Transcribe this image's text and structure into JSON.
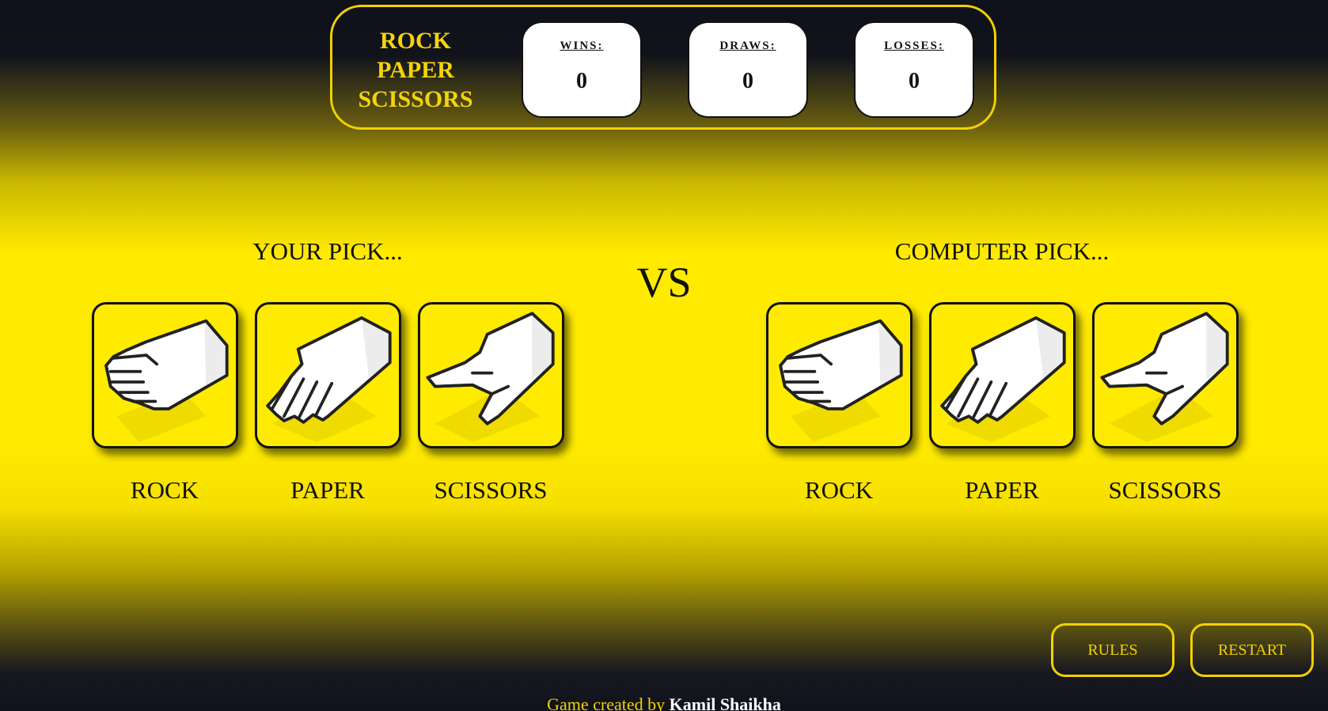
{
  "header": {
    "title_lines": [
      "ROCK",
      "PAPER",
      "SCISSORS"
    ],
    "scores": {
      "wins_label": "WINS:",
      "wins_value": "0",
      "draws_label": "DRAWS:",
      "draws_value": "0",
      "losses_label": "LOSSES:",
      "losses_value": "0"
    }
  },
  "player": {
    "heading": "YOUR PICK...",
    "options": [
      {
        "label": "ROCK",
        "icon": "rock-hand-icon"
      },
      {
        "label": "PAPER",
        "icon": "paper-hand-icon"
      },
      {
        "label": "SCISSORS",
        "icon": "scissors-hand-icon"
      }
    ]
  },
  "vs_text": "VS",
  "computer": {
    "heading": "COMPUTER PICK...",
    "options": [
      {
        "label": "ROCK",
        "icon": "rock-hand-icon"
      },
      {
        "label": "PAPER",
        "icon": "paper-hand-icon"
      },
      {
        "label": "SCISSORS",
        "icon": "scissors-hand-icon"
      }
    ]
  },
  "buttons": {
    "rules": "RULES",
    "restart": "RESTART"
  },
  "footer": {
    "prefix": "Game created by",
    "author": "Kamil Shaikha"
  },
  "colors": {
    "accent_yellow": "#ffea00",
    "gold": "#f2d100",
    "dark_bg": "#10121b"
  }
}
